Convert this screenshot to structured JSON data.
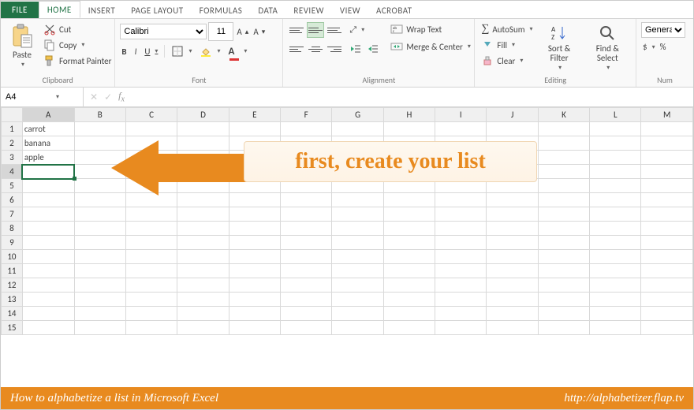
{
  "tabs": {
    "file": "FILE",
    "home": "HOME",
    "insert": "INSERT",
    "pagelayout": "PAGE LAYOUT",
    "formulas": "FORMULAS",
    "data": "DATA",
    "review": "REVIEW",
    "view": "VIEW",
    "acrobat": "ACROBAT"
  },
  "clipboard": {
    "paste": "Paste",
    "cut": "Cut",
    "copy": "Copy",
    "fmtpainter": "Format Painter",
    "label": "Clipboard"
  },
  "font": {
    "name": "Calibri",
    "size": "11",
    "bold": "B",
    "italic": "I",
    "underline": "U",
    "label": "Font"
  },
  "alignment": {
    "wrap": "Wrap Text",
    "merge": "Merge & Center",
    "label": "Alignment"
  },
  "editing": {
    "autosum": "AutoSum",
    "fill": "Fill",
    "clear": "Clear",
    "sortfilter": "Sort & Filter",
    "findselect": "Find & Select",
    "label": "Editing"
  },
  "number": {
    "format": "General",
    "pct": "%",
    "label": "Num"
  },
  "namebox": "A4",
  "columns": [
    "A",
    "B",
    "C",
    "D",
    "E",
    "F",
    "G",
    "H",
    "I",
    "J",
    "K",
    "L",
    "M"
  ],
  "cells": {
    "A1": "carrot",
    "A2": "banana",
    "A3": "apple"
  },
  "callout": "first, create your list",
  "footer": {
    "left": "How to alphabetize a list in Microsoft Excel",
    "right": "http://alphabetizer.flap.tv"
  },
  "currency": "$"
}
